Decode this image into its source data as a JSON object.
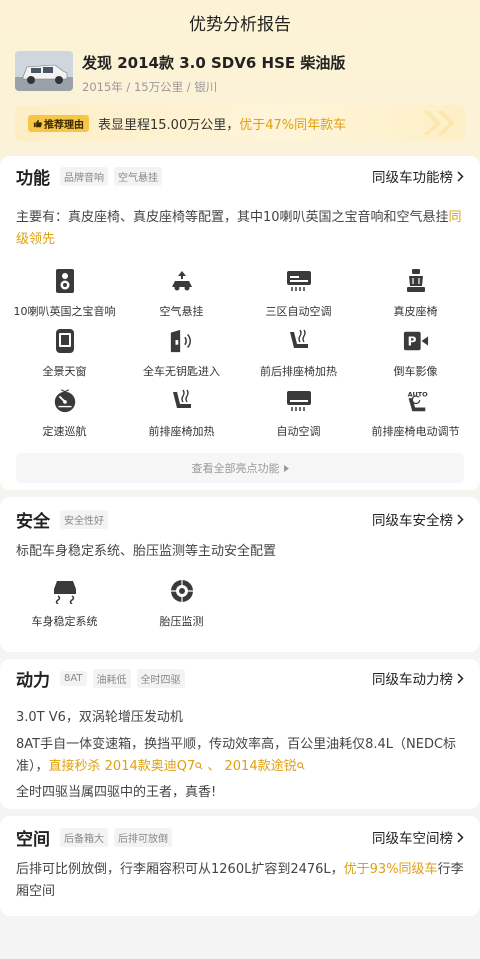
{
  "header": {
    "title": "优势分析报告"
  },
  "car": {
    "name": "发现 2014款 3.0 SDV6 HSE 柴油版",
    "sub": "2015年 / 15万公里 / 银川"
  },
  "reason": {
    "tag": "推荐理由",
    "text": "表显里程15.00万公里，",
    "highlight": "优于47%同年款车"
  },
  "function": {
    "title": "功能",
    "chips": [
      "品牌音响",
      "空气悬挂"
    ],
    "rank": "同级车功能榜",
    "desc": "主要有：真皮座椅、真皮座椅等配置，其中10喇叭英国之宝音响和空气悬挂",
    "desc_hl": "同级领先",
    "features": [
      {
        "label": "10喇叭英国之宝音响",
        "icon": "speaker-icon"
      },
      {
        "label": "空气悬挂",
        "icon": "air-suspension-icon"
      },
      {
        "label": "三区自动空调",
        "icon": "tri-zone-ac-icon"
      },
      {
        "label": "真皮座椅",
        "icon": "leather-seat-icon"
      },
      {
        "label": "全景天窗",
        "icon": "sunroof-icon"
      },
      {
        "label": "全车无钥匙进入",
        "icon": "keyless-entry-icon"
      },
      {
        "label": "前后排座椅加热",
        "icon": "seat-heating-icon"
      },
      {
        "label": "倒车影像",
        "icon": "reverse-camera-icon"
      },
      {
        "label": "定速巡航",
        "icon": "cruise-control-icon"
      },
      {
        "label": "前排座椅加热",
        "icon": "front-seat-heating-icon"
      },
      {
        "label": "自动空调",
        "icon": "auto-ac-icon"
      },
      {
        "label": "前排座椅电动调节",
        "icon": "power-seat-icon"
      }
    ],
    "view_all": "查看全部亮点功能"
  },
  "safety": {
    "title": "安全",
    "chips": [
      "安全性好"
    ],
    "rank": "同级车安全榜",
    "desc": "标配车身稳定系统、胎压监测等主动安全配置",
    "features": [
      {
        "label": "车身稳定系统",
        "icon": "stability-control-icon"
      },
      {
        "label": "胎压监测",
        "icon": "tire-pressure-icon"
      }
    ]
  },
  "power": {
    "title": "动力",
    "chips": [
      "8AT",
      "油耗低",
      "全时四驱"
    ],
    "rank": "同级车动力榜",
    "line1": "3.0T V6，双涡轮增压发动机",
    "line2a": "8AT手自一体变速箱，换挡平顺，传动效率高，百公里油耗仅8.4L（NEDC标准），",
    "line2b": "直接秒杀 2014款奥迪Q7",
    "line2c": " 、 ",
    "line2d": "2014款途锐",
    "line3": "全时四驱当属四驱中的王者，真香!"
  },
  "space": {
    "title": "空间",
    "chips": [
      "后备箱大",
      "后排可放倒"
    ],
    "rank": "同级车空间榜",
    "desc": "后排可比例放倒，行李厢容积可从1260L扩容到2476L，",
    "desc_hl": "优于93%同级车",
    "desc_tail": "行李厢空间"
  },
  "colors": {
    "accent": "#e0a010",
    "tag_bg": "#f7c548"
  }
}
